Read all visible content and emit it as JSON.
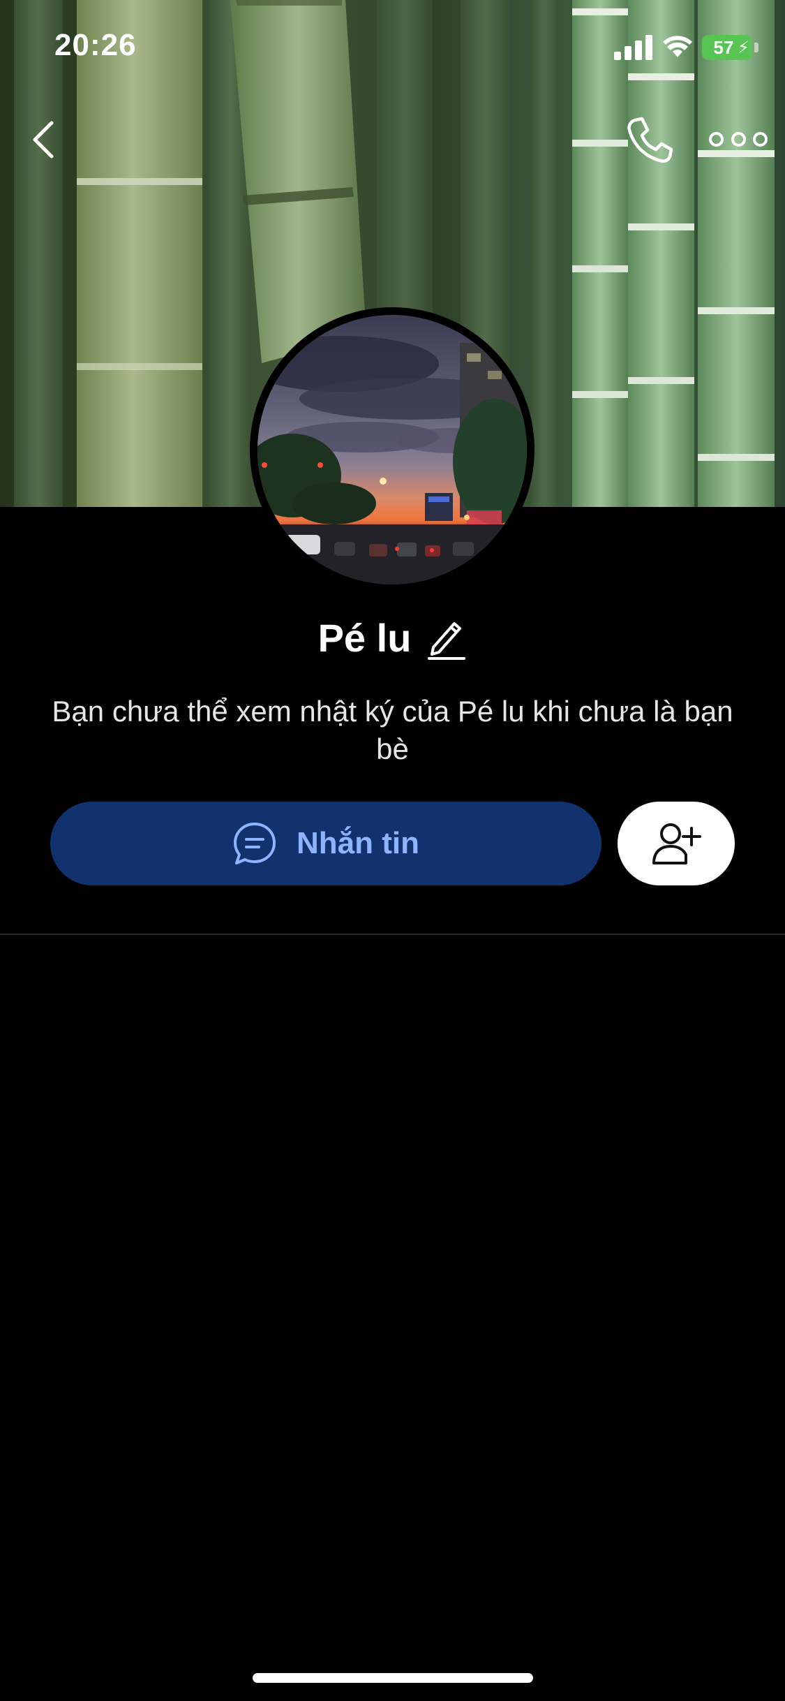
{
  "status_bar": {
    "time": "20:26",
    "battery_level": "57",
    "battery_charging": true
  },
  "nav": {
    "back_icon": "chevron-left-icon",
    "call_icon": "phone-icon",
    "more_icon": "more-horizontal-icon"
  },
  "profile": {
    "name": "Pé lu",
    "edit_icon": "pencil-icon",
    "diary_notice": "Bạn chưa thể xem nhật ký của Pé lu khi chưa là bạn bè"
  },
  "actions": {
    "message_label": "Nhắn tin",
    "message_icon": "chat-bubble-icon",
    "add_friend_icon": "add-user-icon"
  },
  "colors": {
    "background": "#000000",
    "message_button_bg": "#12326e",
    "message_button_text": "#8fb4ff",
    "battery_green": "#57c454"
  }
}
